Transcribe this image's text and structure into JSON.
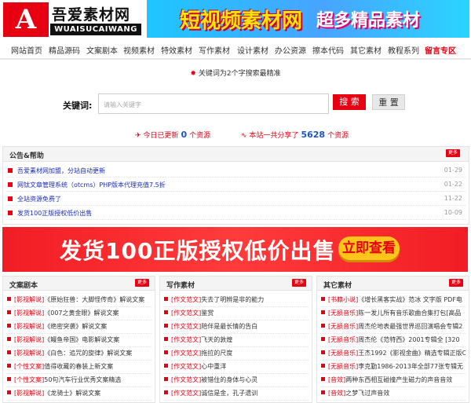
{
  "header": {
    "logo_mark": "A",
    "logo_cn": "吾爱素材网",
    "logo_en": "WUAISUCAIWANG",
    "banner_left": "短视频素材网",
    "banner_right": "超多精品素材"
  },
  "nav": [
    "网站首页",
    "精品源码",
    "文案剧本",
    "视频素材",
    "特效素材",
    "写作素材",
    "设计素材",
    "办公资源",
    "擦本代码",
    "其它素材",
    "教程系列",
    "留言专区"
  ],
  "hot_notice": "关键词为2个字搜索最精准",
  "search": {
    "label": "关键词:",
    "placeholder": "请输入关键字",
    "search_button": "搜 索",
    "reset_button": "重 置"
  },
  "stats": {
    "today_prefix": "今日已更新",
    "today_count": "0",
    "today_suffix": "个资源",
    "total_prefix": "本站一共分享了",
    "total_count": "5628",
    "total_suffix": "个资源"
  },
  "notice": {
    "title": "公告&帮助",
    "more": "更多",
    "items": [
      {
        "text": "吾爱素材网加盟，分站自动更新",
        "date": "01-29"
      },
      {
        "text": "网钛文章管理系统（otcms）PHP版本代理充值7.5折",
        "date": "01-22"
      },
      {
        "text": "全站资源免费了",
        "date": "11-22"
      },
      {
        "text": "发货100正版授权低价出售",
        "date": "10-09"
      }
    ]
  },
  "ad": {
    "text": "发货100正版授权低价出售",
    "button": "立即查看"
  },
  "columns": [
    {
      "title": "文案剧本",
      "more": "更多",
      "items": [
        {
          "tag": "[影视解说]",
          "title": "《原始狂兽：大脚怪传奇》解说文案"
        },
        {
          "tag": "[影视解说]",
          "title": "《007之黄金眼》解说文案"
        },
        {
          "tag": "[影视解说]",
          "title": "《绝密突袭》解说文案"
        },
        {
          "tag": "[影视解说]",
          "title": "《鳗鱼帝国》电影解说文案"
        },
        {
          "tag": "[影视解说]",
          "title": "《白色：追咒的旋律》解说文案"
        },
        {
          "tag": "[个性文案]",
          "title": "值得收藏的春装上新文案"
        },
        {
          "tag": "[个性文案]",
          "title": "50句汽车行业优秀文案精选"
        },
        {
          "tag": "[影视解说]",
          "title": "《龙骑士》解说文案"
        }
      ]
    },
    {
      "title": "写作素材",
      "more": "更多",
      "items": [
        {
          "tag": "[作文范文]",
          "title": "失去了明辨是非的能力"
        },
        {
          "tag": "[作文范文]",
          "title": "鉴赏"
        },
        {
          "tag": "[作文范文]",
          "title": "陪伴是最长情的告白"
        },
        {
          "tag": "[作文范文]",
          "title": "飞天的敦煌"
        },
        {
          "tag": "[作文范文]",
          "title": "拖拉的尺度"
        },
        {
          "tag": "[作文范文]",
          "title": "心中重洋"
        },
        {
          "tag": "[作文范文]",
          "title": "被错住的身体与心灵"
        },
        {
          "tag": "[作文范文]",
          "title": "诚信是金，孔子遗训"
        }
      ]
    },
    {
      "title": "其它素材",
      "more": "更多",
      "items": [
        {
          "tag": "[书籍小说]",
          "title": "《增长黑客实战》范冰 文字版 PDF电"
        },
        {
          "tag": "[无损音乐]",
          "title": "陈一发儿所有音乐歌曲合集打包[高品"
        },
        {
          "tag": "[无损音乐]",
          "title": "周杰伦地表最强世界巡回演唱会专辑2"
        },
        {
          "tag": "[无损音乐]",
          "title": "周杰伦《范特西》2001专辑全 [320"
        },
        {
          "tag": "[无损音乐]",
          "title": "王杰1992《影视金曲》精选专辑正版C"
        },
        {
          "tag": "[无损音乐]",
          "title": "李克勤1986-2013年全部77张专辑无"
        },
        {
          "tag": "[音效]",
          "title": "两种东西相互碰撞产生磁力的声音音效"
        },
        {
          "tag": "[音效]",
          "title": "之梦飞过声音效"
        }
      ]
    }
  ]
}
